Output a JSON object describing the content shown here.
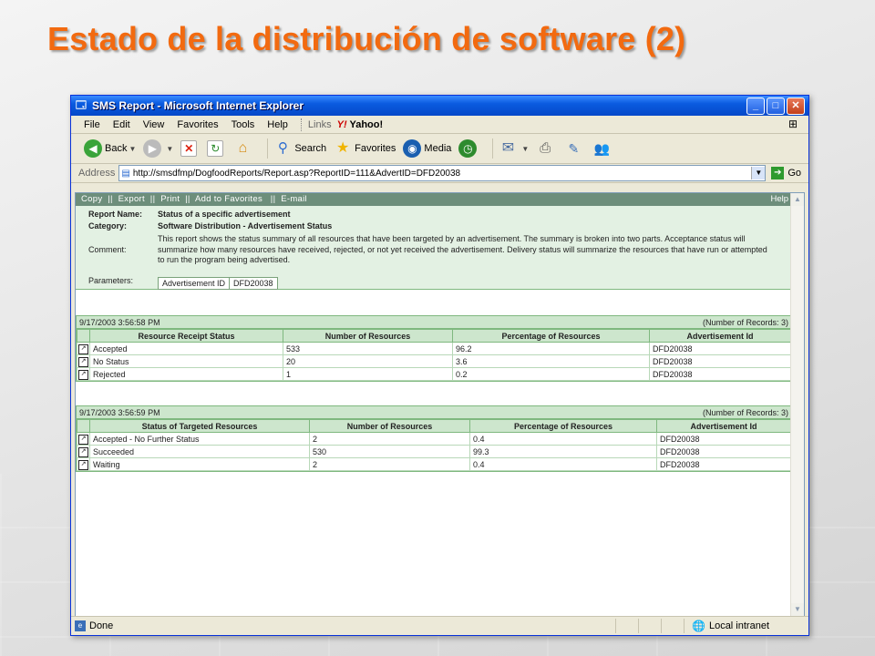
{
  "slide": {
    "title": "Estado de la distribución de software (2)"
  },
  "window": {
    "title": "SMS Report - Microsoft Internet Explorer",
    "controls": {
      "minimize": "_",
      "maximize": "□",
      "close": "✕"
    }
  },
  "menu": {
    "items": [
      "File",
      "Edit",
      "View",
      "Favorites",
      "Tools",
      "Help"
    ],
    "links_label": "Links",
    "yahoo_label": "Yahoo!"
  },
  "toolbar": {
    "back": "Back",
    "search": "Search",
    "favorites": "Favorites",
    "media": "Media"
  },
  "address": {
    "label": "Address",
    "url": "http://smsdfmp/DogfoodReports/Report.asp?ReportID=111&AdvertID=DFD20038",
    "go": "Go"
  },
  "report": {
    "actions": "Copy  ||  Export  ||  Print  ||  Add to Favorites   ||  E-mail",
    "help": "Help",
    "name_label": "Report Name:",
    "name": "Status of a specific advertisement",
    "category_label": "Category:",
    "category": "Software Distribution - Advertisement Status",
    "comment_label": "Comment:",
    "comment": "This report shows the status summary of all resources that have been targeted by an advertisement. The summary is broken into two parts. Acceptance status will summarize how many resources have received, rejected, or not yet received the advertisement. Delivery status will summarize the resources that have run or attempted to run the program being advertised.",
    "parameters_label": "Parameters:",
    "param_name": "Advertisement ID",
    "param_value": "DFD20038"
  },
  "table1": {
    "timestamp": "9/17/2003 3:56:58 PM",
    "records": "(Number of Records: 3)",
    "headers": [
      "Resource Receipt Status",
      "Number of Resources",
      "Percentage of Resources",
      "Advertisement Id"
    ],
    "rows": [
      [
        "Accepted",
        "533",
        "96.2",
        "DFD20038"
      ],
      [
        "No Status",
        "20",
        "3.6",
        "DFD20038"
      ],
      [
        "Rejected",
        "1",
        "0.2",
        "DFD20038"
      ]
    ]
  },
  "table2": {
    "timestamp": "9/17/2003 3:56:59 PM",
    "records": "(Number of Records: 3)",
    "headers": [
      "Status of Targeted Resources",
      "Number of Resources",
      "Percentage of Resources",
      "Advertisement Id"
    ],
    "rows": [
      [
        "Accepted - No Further Status",
        "2",
        "0.4",
        "DFD20038"
      ],
      [
        "Succeeded",
        "530",
        "99.3",
        "DFD20038"
      ],
      [
        "Waiting",
        "2",
        "0.4",
        "DFD20038"
      ]
    ]
  },
  "status": {
    "done": "Done",
    "zone": "Local intranet"
  }
}
